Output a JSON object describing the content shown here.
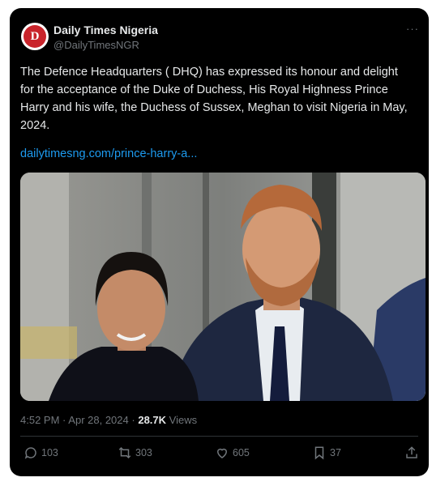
{
  "author": {
    "display_name": "Daily Times Nigeria",
    "handle": "@DailyTimesNGR",
    "avatar_letter": "D",
    "avatar_color": "#c9242b"
  },
  "more_label": "···",
  "post": {
    "text": "The Defence Headquarters ( DHQ) has expressed its honour and delight for the acceptance of the Duke of Duchess, His Royal Highness Prince Harry and his wife, the Duchess of Sussex, Meghan to visit Nigeria in May, 2024.",
    "link": "dailytimesng.com/prince-harry-a..."
  },
  "meta": {
    "time": "4:52 PM",
    "separator": "·",
    "date": "Apr 28, 2024",
    "views_count": "28.7K",
    "views_label": "Views"
  },
  "actions": {
    "replies": "103",
    "reposts": "303",
    "likes": "605",
    "bookmarks": "37"
  },
  "colors": {
    "background": "#000000",
    "text": "#e7e9ea",
    "muted": "#71767b",
    "link": "#1d9bf0",
    "divider": "#2f3336"
  }
}
